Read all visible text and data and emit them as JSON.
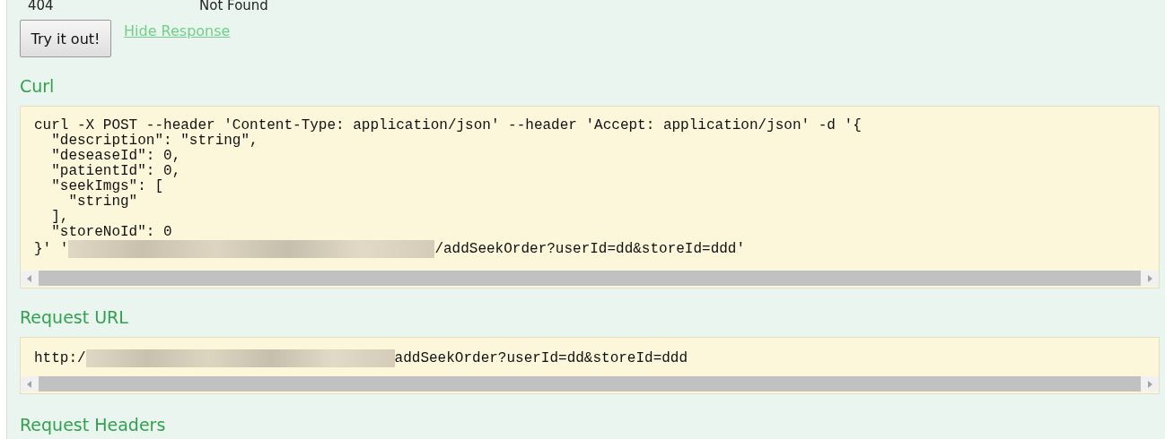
{
  "response_row": {
    "code": "404",
    "text": "Not Found"
  },
  "try_button": "Try it out!",
  "hide_link": "Hide Response",
  "curl": {
    "heading": "Curl",
    "lines": [
      "curl -X POST --header 'Content-Type: application/json' --header 'Accept: application/json' -d '{",
      "  \"description\": \"string\",",
      "  \"deseaseId\": 0,",
      "  \"patientId\": 0,",
      "  \"seekImgs\": [",
      "    \"string\"",
      "  ],",
      "  \"storeNoId\": 0"
    ],
    "last_prefix": "}' '",
    "last_suffix": "/addSeekOrder?userId=dd&storeId=ddd'"
  },
  "request_url": {
    "heading": "Request URL",
    "prefix": "http:/",
    "suffix": "addSeekOrder?userId=dd&storeId=ddd"
  },
  "next_heading": "Request Headers"
}
